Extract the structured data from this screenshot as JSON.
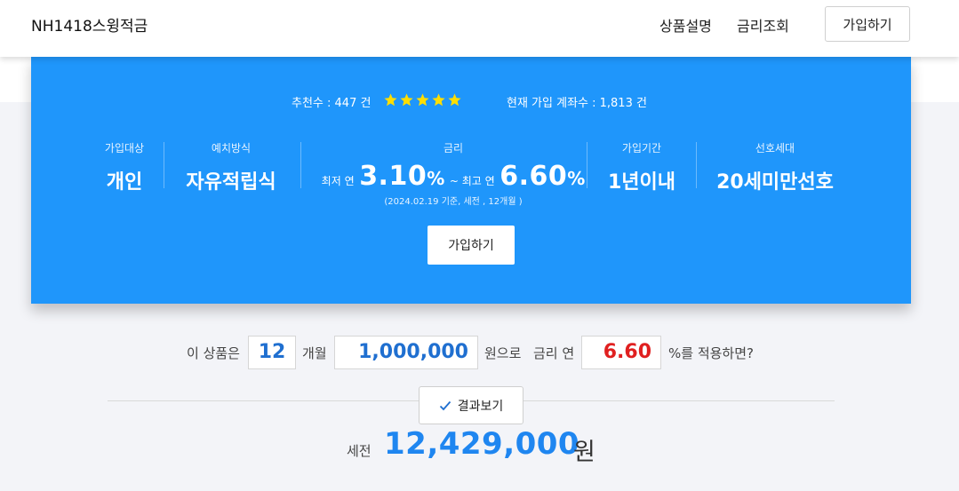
{
  "header": {
    "brand": "NH1418스윙적금",
    "nav": [
      "상품설명",
      "금리조회"
    ],
    "join_label": "가입하기"
  },
  "hero": {
    "recommend_text": "추천수 : 447 건",
    "stars": 5,
    "accounts_text": "현재 가입 계좌수 : 1,813 건",
    "columns": [
      {
        "label": "가입대상",
        "value": "개인"
      },
      {
        "label": "예치방식",
        "value": "자유적립식"
      },
      {
        "label": "금리"
      },
      {
        "label": "가입기간",
        "value": "1년이내"
      },
      {
        "label": "선호세대",
        "value": "20세미만선호"
      }
    ],
    "rate": {
      "min_prefix": "최저 연",
      "min_value": "3.10",
      "tilde_max_prefix": "~ 최고 연",
      "max_value": "6.60",
      "pct": "%",
      "note": "(2024.02.19 기준, 세전 , 12개월 )"
    },
    "join_label": "가입하기"
  },
  "calculator": {
    "text_1": "이 상품은",
    "months": "12",
    "text_2": "개월",
    "amount": "1,000,000",
    "text_3": "원으로",
    "text_4": "금리 연",
    "rate": "6.60",
    "text_5": "%를 적용하면?",
    "result_button": "결과보기",
    "result_label": "세전",
    "result_value": "12,429,000",
    "result_unit": "원"
  },
  "colors": {
    "hero_blue": "#1f96fb",
    "star_yellow": "#ffde00",
    "months_blue": "#1f6fd0",
    "rate_red": "#e02020",
    "result_blue": "#1f86f0"
  }
}
